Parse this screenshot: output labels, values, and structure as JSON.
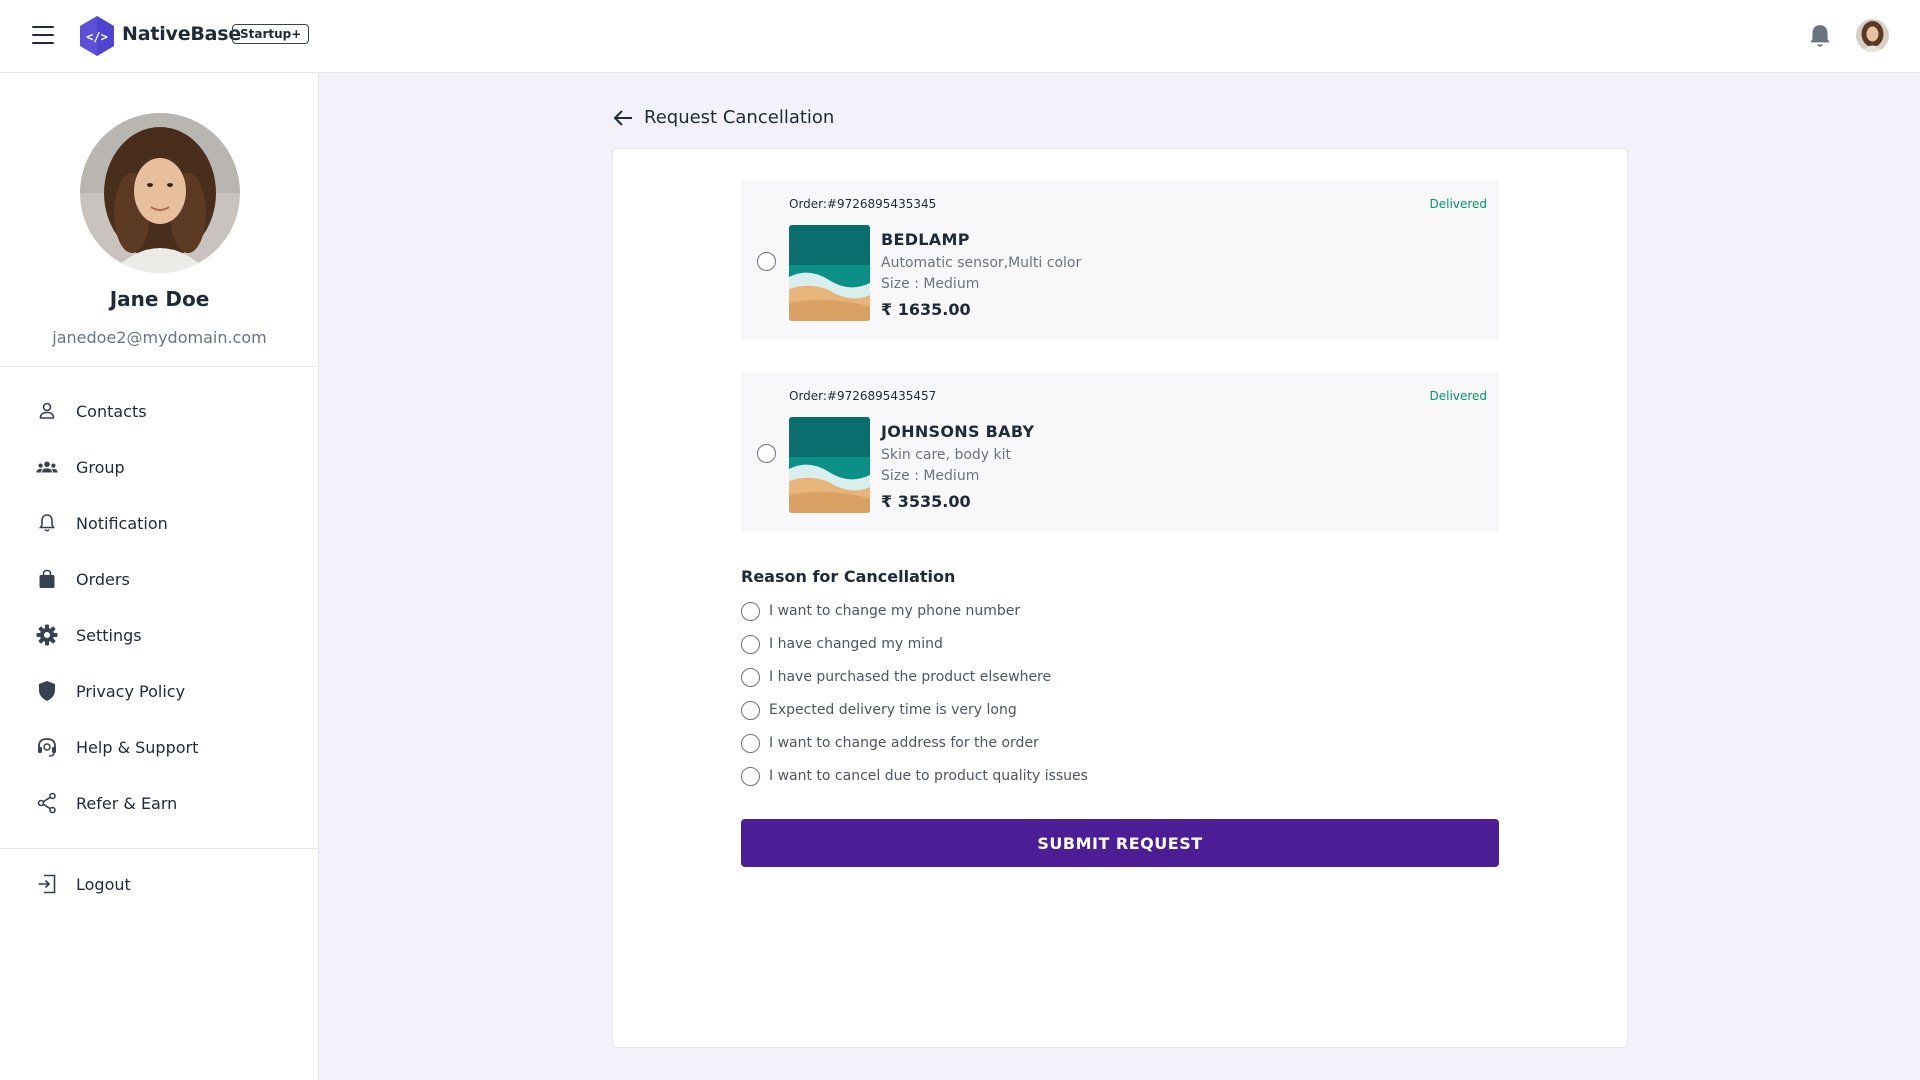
{
  "header": {
    "brand": "NativeBase",
    "badge": "Startup+"
  },
  "profile": {
    "name": "Jane Doe",
    "email": "janedoe2@mydomain.com"
  },
  "sidebar": {
    "items": [
      {
        "label": "Contacts",
        "icon": "user-icon"
      },
      {
        "label": "Group",
        "icon": "group-icon"
      },
      {
        "label": "Notification",
        "icon": "bell-icon"
      },
      {
        "label": "Orders",
        "icon": "shopping-bag-icon"
      },
      {
        "label": "Settings",
        "icon": "gear-icon"
      },
      {
        "label": "Privacy Policy",
        "icon": "shield-icon"
      },
      {
        "label": "Help & Support",
        "icon": "headset-icon"
      },
      {
        "label": "Refer & Earn",
        "icon": "share-icon"
      }
    ],
    "logout": {
      "label": "Logout",
      "icon": "logout-icon"
    }
  },
  "page": {
    "title": "Request Cancellation"
  },
  "orders": [
    {
      "order_no": "Order:#9726895435345",
      "status": "Delivered",
      "name": "BEDLAMP",
      "description": "Automatic sensor,Multi color",
      "size": "Size : Medium",
      "price": "₹ 1635.00"
    },
    {
      "order_no": "Order:#9726895435457",
      "status": "Delivered",
      "name": "JOHNSONS BABY",
      "description": "Skin care, body kit",
      "size": "Size : Medium",
      "price": "₹ 3535.00"
    }
  ],
  "reasons": {
    "title": "Reason for Cancellation",
    "options": [
      "I want to change my phone number",
      "I have changed my mind",
      "I have purchased the product elsewhere",
      "Expected delivery time is very long",
      "I want to change address for the order",
      "I want to cancel due to product quality issues"
    ]
  },
  "submit_label": "SUBMIT REQUEST",
  "colors": {
    "accent": "#4c1d95",
    "status_delivered": "#059669",
    "background": "#f3f2fb"
  }
}
